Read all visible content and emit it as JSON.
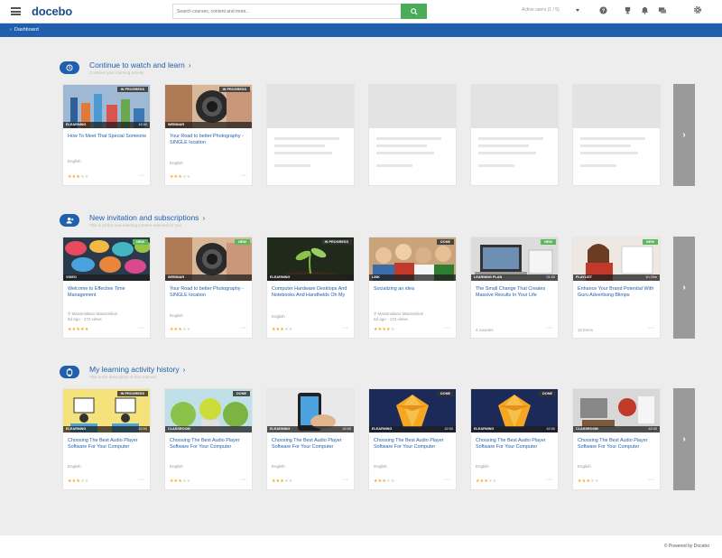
{
  "header": {
    "logo": "docebo",
    "search_placeholder": "Search courses, content and more...",
    "language": "Active users (1 / 5)"
  },
  "breadcrumb": {
    "label": "Dashboard"
  },
  "sections": [
    {
      "title": "Continue to watch and learn",
      "subtitle": "Continue your learning activity",
      "cards": [
        {
          "status": "IN PROGRESS",
          "type": "ELEARNING",
          "duration": "42:00",
          "title": "How To Meet That Special Someone",
          "meta": "English",
          "rating": 3
        },
        {
          "status": "IN PROGRESS",
          "type": "WEBINAR",
          "duration": "",
          "title": "Your Road to better Photography - SINGLE location",
          "meta": "English",
          "rating": 3
        }
      ]
    },
    {
      "title": "New invitation and subscriptions",
      "subtitle": "This is all the new learning content selected for you",
      "cards": [
        {
          "status": "NEW",
          "type": "VIDEO",
          "duration": "",
          "title": "Welcome to Effective Time Management",
          "meta": "Massimiliano Massimilian",
          "meta2": "6d ago - 172 views",
          "rating": 5
        },
        {
          "status": "",
          "type": "WEBINAR",
          "duration": "",
          "title": "Your Road to better Photography - SINGLE location",
          "meta": "English",
          "rating": 3
        },
        {
          "status": "IN PROGRESS",
          "type": "ELEARNING",
          "duration": "",
          "title": "Computer Hardware Desktops And Notebooks And Handhelds Oh My",
          "meta": "English",
          "rating": 3
        },
        {
          "status": "DONE",
          "type": "LINK",
          "duration": "",
          "title": "Socializing an idea",
          "meta": "Massimiliano Massimilian",
          "meta2": "6d ago - 172 views",
          "rating": 4
        },
        {
          "status": "NEW",
          "type": "LEARNING PLAN",
          "duration": "01:00",
          "title": "The Small Change That Creates Massive Results In Your Life",
          "foot": "4 courses",
          "rating": 0
        },
        {
          "status": "NEW",
          "type": "PLAYLIST",
          "duration": "1h 20m",
          "title": "Enhance Your Brand Potential With Guru Advertising Blimps",
          "foot": "10 items",
          "rating": 0
        }
      ]
    },
    {
      "title": "My learning activity history",
      "subtitle": "This is the description of this channel",
      "cards": [
        {
          "status": "IN PROGRESS",
          "type": "ELEARNING",
          "duration": "42:00",
          "title": "Choosing The Best Audio Player Software For Your Computer",
          "meta": "English",
          "rating": 3
        },
        {
          "status": "DONE",
          "type": "CLASSROOM",
          "duration": "",
          "title": "Choosing The Best Audio Player Software For Your Computer",
          "meta": "English",
          "rating": 3
        },
        {
          "status": "",
          "type": "ELEARNING",
          "duration": "42:00",
          "title": "Choosing The Best Audio Player Software For Your Computer",
          "meta": "English",
          "rating": 3
        },
        {
          "status": "DONE",
          "type": "ELEARNING",
          "duration": "42:00",
          "title": "Choosing The Best Audio Player Software For Your Computer",
          "meta": "English",
          "rating": 3
        },
        {
          "status": "DONE",
          "type": "ELEARNING",
          "duration": "42:00",
          "title": "Choosing The Best Audio Player Software For Your Computer",
          "meta": "English",
          "rating": 3
        },
        {
          "status": "",
          "type": "CLASSROOM",
          "duration": "42:00",
          "title": "Choosing The Best Audio Player Software For Your Computer",
          "meta": "English",
          "rating": 3
        }
      ]
    }
  ],
  "footer": {
    "text": "© Powered by Docebo"
  },
  "colors": {
    "brand": "#1f5fae",
    "search_button": "#4aab59",
    "star": "#f5a623",
    "new_badge": "#5cb85c"
  }
}
